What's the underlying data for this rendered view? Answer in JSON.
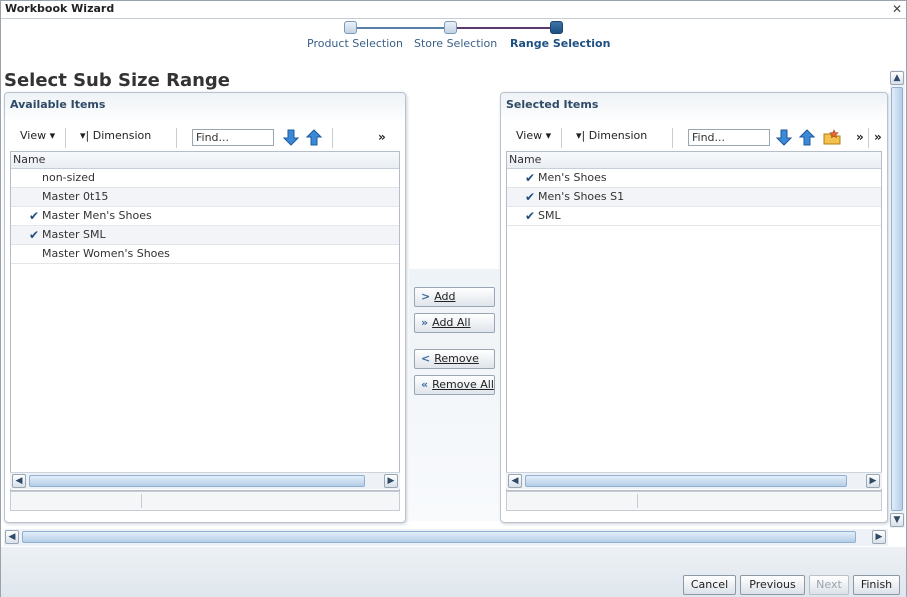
{
  "window": {
    "title": "Workbook Wizard"
  },
  "train": {
    "steps": [
      {
        "label": "Product Selection",
        "current": false
      },
      {
        "label": "Store Selection",
        "current": false
      },
      {
        "label": "Range Selection",
        "current": true
      }
    ]
  },
  "page_title": "Select Sub Size Range",
  "available": {
    "header": "Available Items",
    "toolbar": {
      "view": "View",
      "dimension": "Dimension",
      "find_placeholder": "Find..."
    },
    "column": "Name",
    "rows": [
      {
        "label": "non-sized",
        "checked": false
      },
      {
        "label": "Master 0t15",
        "checked": false
      },
      {
        "label": "Master Men's Shoes",
        "checked": true
      },
      {
        "label": "Master SML",
        "checked": true
      },
      {
        "label": "Master Women's Shoes",
        "checked": false
      }
    ]
  },
  "selected": {
    "header": "Selected Items",
    "toolbar": {
      "view": "View",
      "dimension": "Dimension",
      "find_placeholder": "Find..."
    },
    "column": "Name",
    "rows": [
      {
        "label": "Men's Shoes",
        "checked": true
      },
      {
        "label": "Men's Shoes S1",
        "checked": true
      },
      {
        "label": "SML",
        "checked": true
      }
    ]
  },
  "shuttle": {
    "add": "Add",
    "add_all": "Add All",
    "remove": "Remove",
    "remove_all": "Remove All"
  },
  "footer": {
    "cancel": "Cancel",
    "previous": "Previous",
    "next": "Next",
    "finish": "Finish"
  },
  "icons": {
    "close": "close-icon",
    "move_down": "arrow-down-icon",
    "move_up": "arrow-up-icon",
    "folder": "folder-star-icon",
    "check": "checkmark-icon"
  },
  "colors": {
    "accent": "#1d4f80",
    "header_text": "#2e4a66",
    "arrow_blue": "#3b8ad9"
  }
}
